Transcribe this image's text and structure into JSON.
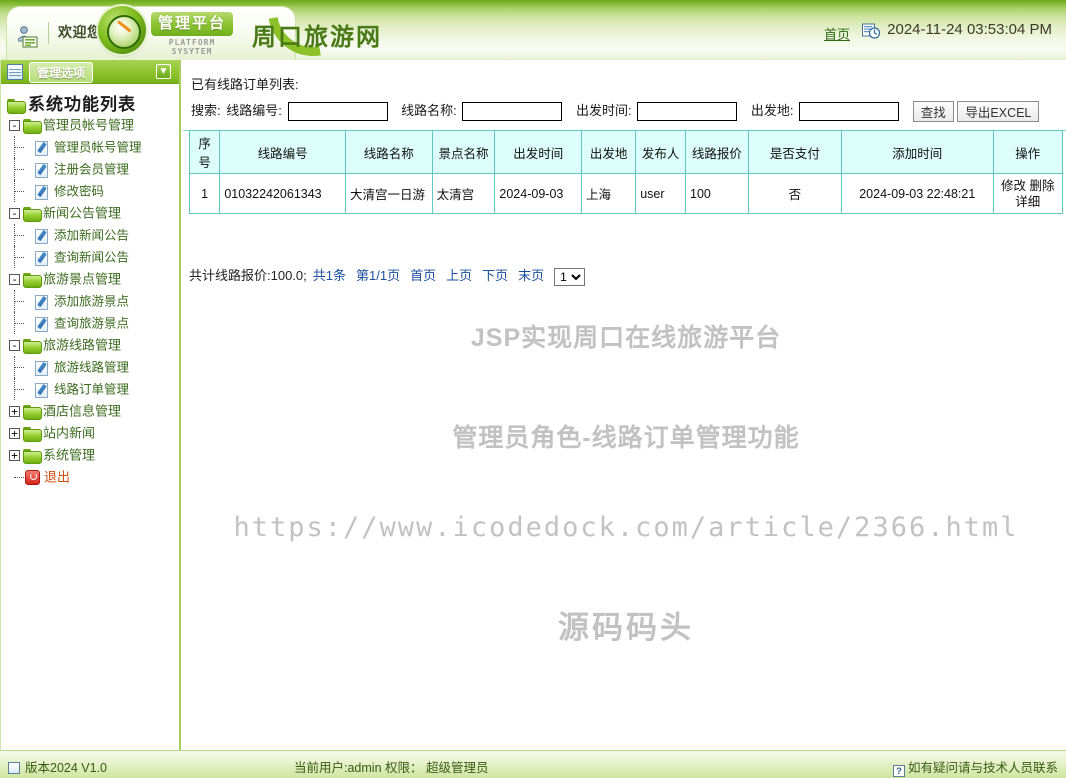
{
  "header": {
    "welcome_text": "欢迎您–",
    "platform_badge": "管理平台",
    "platform_sub": "PLATFORM SYSYTEM",
    "site_title": "周口旅游网",
    "home_link": "首页",
    "datetime": "2024-11-24 03:53:04 PM"
  },
  "sidebar": {
    "panel_label": "管理选项",
    "tree_title": "系统功能列表",
    "items": [
      {
        "label": "管理员帐号管理",
        "level": 0,
        "icon": "folder-icon",
        "expander": "-"
      },
      {
        "label": "管理员帐号管理",
        "level": 1,
        "icon": "pen-icon"
      },
      {
        "label": "注册会员管理",
        "level": 1,
        "icon": "pen-icon"
      },
      {
        "label": "修改密码",
        "level": 1,
        "icon": "pen-icon"
      },
      {
        "label": "新闻公告管理",
        "level": 0,
        "icon": "folder-icon",
        "expander": "-"
      },
      {
        "label": "添加新闻公告",
        "level": 1,
        "icon": "pen-icon"
      },
      {
        "label": "查询新闻公告",
        "level": 1,
        "icon": "pen-icon"
      },
      {
        "label": "旅游景点管理",
        "level": 0,
        "icon": "folder-icon",
        "expander": "-"
      },
      {
        "label": "添加旅游景点",
        "level": 1,
        "icon": "pen-icon"
      },
      {
        "label": "查询旅游景点",
        "level": 1,
        "icon": "pen-icon"
      },
      {
        "label": "旅游线路管理",
        "level": 0,
        "icon": "folder-icon",
        "expander": "-"
      },
      {
        "label": "旅游线路管理",
        "level": 1,
        "icon": "pen-icon"
      },
      {
        "label": "线路订单管理",
        "level": 1,
        "icon": "pen-icon"
      },
      {
        "label": "酒店信息管理",
        "level": 0,
        "icon": "folder-icon",
        "expander": "+"
      },
      {
        "label": "站内新闻",
        "level": 0,
        "icon": "folder-icon",
        "expander": "+"
      },
      {
        "label": "系统管理",
        "level": 0,
        "icon": "folder-icon",
        "expander": "+"
      },
      {
        "label": "退出",
        "level": 0,
        "icon": "exit-icon",
        "expander": ""
      }
    ]
  },
  "main": {
    "panel_title": "已有线路订单列表:",
    "search": {
      "prefix_label": "搜索:",
      "code_label": "线路编号:",
      "code_value": "",
      "name_label": "线路名称:",
      "name_value": "",
      "time_label": "出发时间:",
      "time_value": "",
      "place_label": "出发地:",
      "place_value": "",
      "find_button": "查找",
      "export_button": "导出EXCEL"
    },
    "table": {
      "headers": [
        "序号",
        "线路编号",
        "线路名称",
        "景点名称",
        "出发时间",
        "出发地",
        "发布人",
        "线路报价",
        "是否支付",
        "添加时间",
        "操作"
      ],
      "rows": [
        {
          "index": "1",
          "code": "01032242061343",
          "line_name": "大清宫一日游",
          "spot_name": "太清宫",
          "depart_time": "2024-09-03",
          "depart_place": "上海",
          "publisher": "user",
          "price": "100",
          "paid": "否",
          "added_time": "2024-09-03 22:48:21",
          "ops": [
            "修改",
            "删除",
            "详细"
          ]
        }
      ]
    },
    "pager": {
      "total_price": "共计线路报价:100.0;",
      "count": "共1条",
      "page_info": "第1/1页",
      "first": "首页",
      "prev": "上页",
      "next": "下页",
      "last": "末页",
      "selected_page": "1",
      "page_options": [
        "1"
      ]
    },
    "watermarks": {
      "line1": "JSP实现周口在线旅游平台",
      "line2": "管理员角色-线路订单管理功能",
      "line3": "https://www.icodedock.com/article/2366.html",
      "line4": "源码码头"
    }
  },
  "footer": {
    "version": "版本2024 V1.0",
    "current_user": "当前用户:admin 权限： 超级管理员",
    "contact": "如有疑问请与技术人员联系",
    "qmark": "?"
  },
  "colors": {
    "brand_green": "#8dc029",
    "header_green": "#6aa81e",
    "table_header": "#ddfdfb",
    "table_border": "#5fc8c2",
    "link_blue": "#1b4f9e",
    "watermark_gray": "#c2c2c2"
  }
}
